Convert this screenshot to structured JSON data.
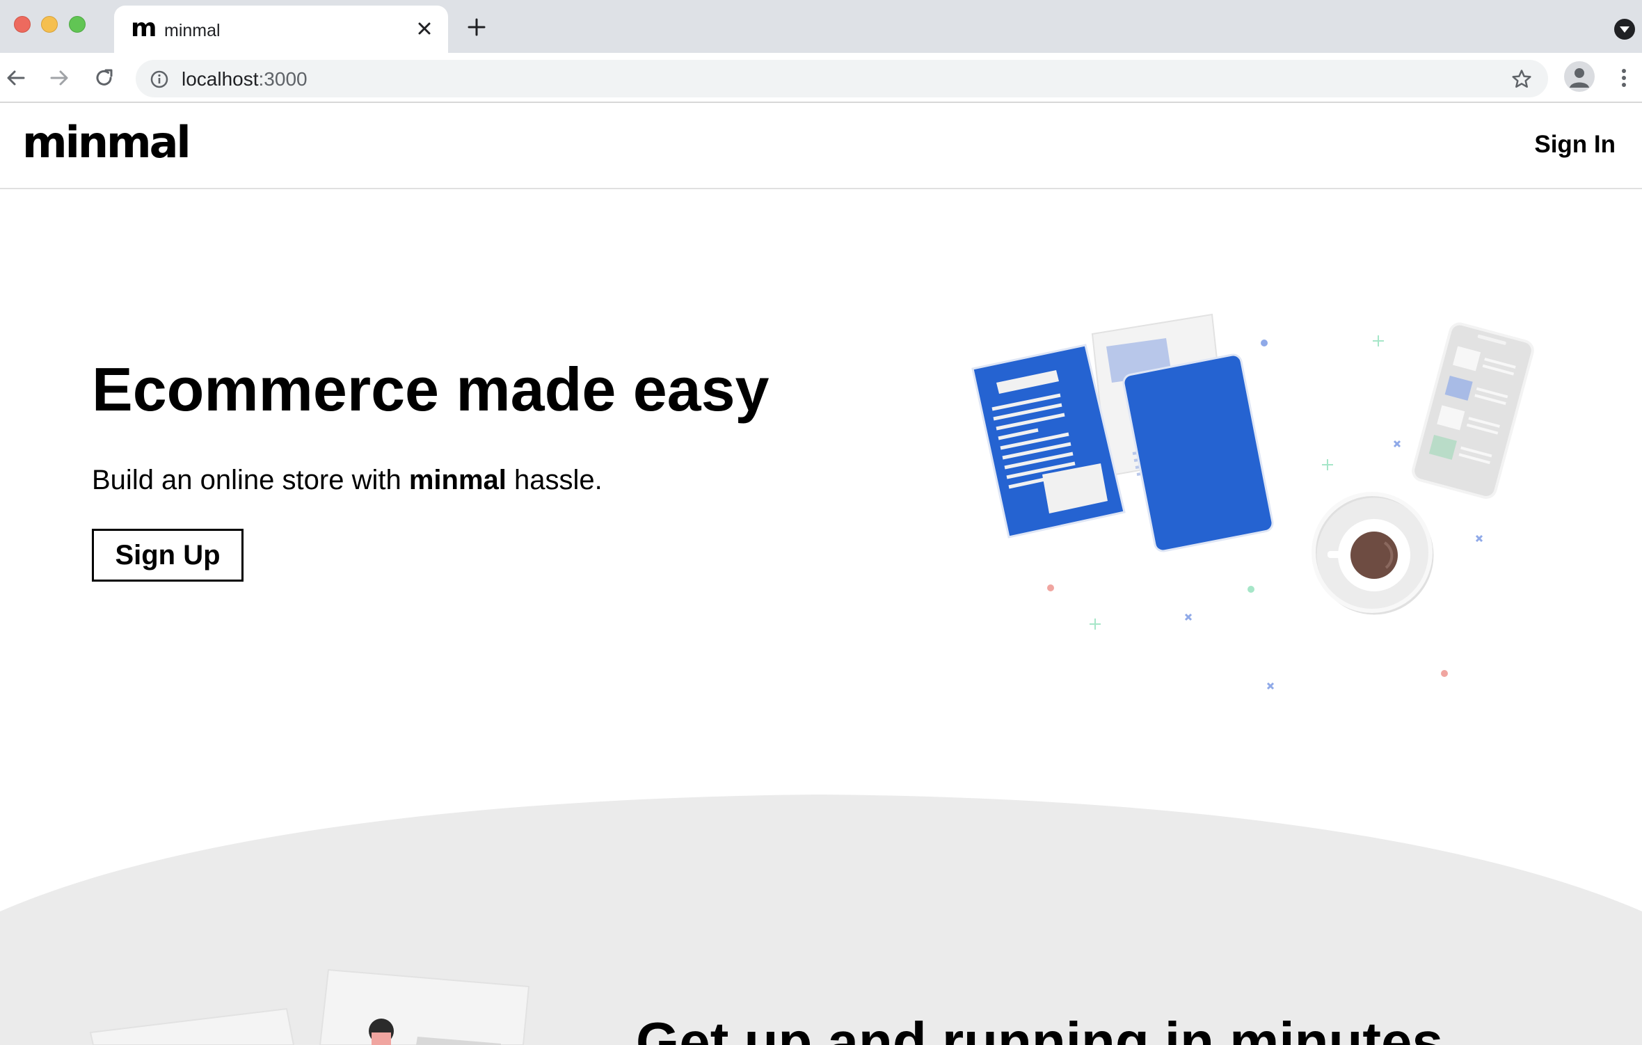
{
  "browser": {
    "tab": {
      "title": "minmal",
      "favicon_icon": "minmal-favicon-icon",
      "favicon_glyph": "m"
    },
    "address_bar": {
      "host": "localhost",
      "port": ":3000"
    },
    "icons": [
      "back-arrow-icon",
      "forward-arrow-icon",
      "reload-icon",
      "info-icon",
      "star-icon",
      "profile-icon",
      "kebab-menu-icon",
      "close-icon",
      "plus-icon",
      "tab-search-icon"
    ]
  },
  "header": {
    "logo": "minmal",
    "sign_in_label": "Sign In"
  },
  "hero": {
    "title": "Ecommerce made easy",
    "subtitle_before": "Build an online store with ",
    "subtitle_bold": "minmal",
    "subtitle_after": " hassle.",
    "signup_label": "Sign Up"
  },
  "section2": {
    "title": "Get up and running in minutes"
  },
  "colors": {
    "accent_blue": "#2563d1",
    "light_blue": "#b8c7ea",
    "section_gray": "#ebebeb",
    "coffee": "#6e4c42"
  }
}
